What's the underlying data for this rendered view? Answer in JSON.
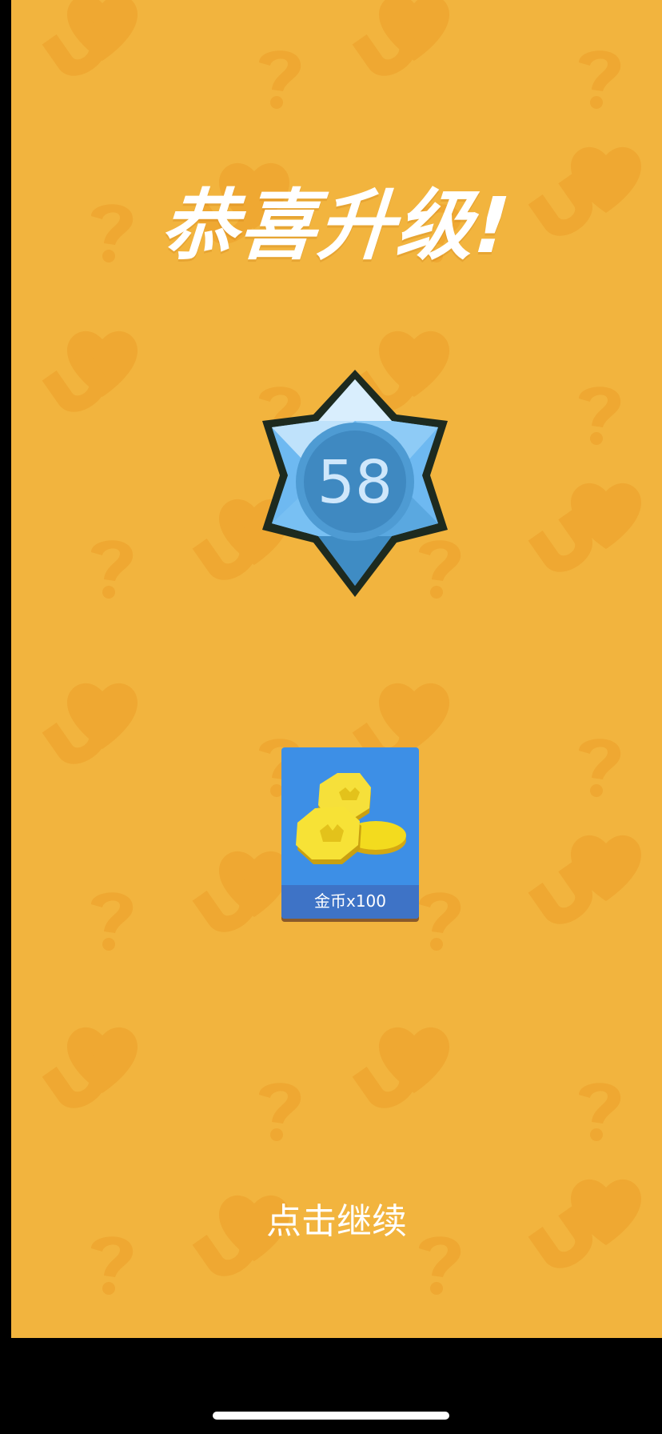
{
  "title": "恭喜升级!",
  "level_badge": {
    "level": "58",
    "icon": "star-hexagram-badge-icon"
  },
  "reward": {
    "icon": "gold-coins-icon",
    "label": "金币x100"
  },
  "continue_text": "点击继续",
  "colors": {
    "background": "#F2B43E",
    "pattern": "#EFA832",
    "badge_light": "#A9D8FB",
    "badge_mid": "#6EB9F1",
    "badge_dark": "#3F8CC4",
    "reward_card": "#3D8FE6",
    "reward_label_bar": "#3E73C6",
    "coin": "#F3DB1E",
    "text": "#FFFFFF"
  }
}
